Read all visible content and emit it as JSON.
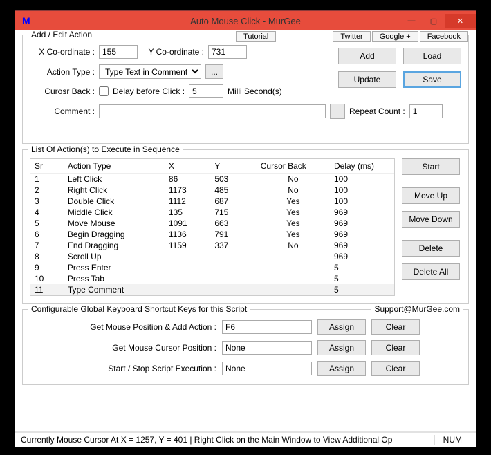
{
  "window": {
    "title": "Auto Mouse Click - MurGee",
    "icon_letter": "M"
  },
  "links": {
    "tutorial": "Tutorial",
    "twitter": "Twitter",
    "google": "Google +",
    "facebook": "Facebook"
  },
  "addEdit": {
    "legend": "Add / Edit Action",
    "xcoord_lbl": "X Co-ordinate :",
    "xcoord_val": "155",
    "ycoord_lbl": "Y Co-ordinate :",
    "ycoord_val": "731",
    "action_type_lbl": "Action Type :",
    "action_type_val": "Type Text in Comment",
    "ellipsis": "...",
    "cursor_back_lbl": "Curosr Back :",
    "delay_lbl": "Delay before Click :",
    "delay_val": "5",
    "delay_unit": "Milli Second(s)",
    "comment_lbl": "Comment :",
    "repeat_lbl": "Repeat Count :",
    "repeat_val": "1",
    "add_btn": "Add",
    "load_btn": "Load",
    "update_btn": "Update",
    "save_btn": "Save"
  },
  "list": {
    "legend": "List Of Action(s) to Execute in Sequence",
    "headers": {
      "sr": "Sr",
      "type": "Action Type",
      "x": "X",
      "y": "Y",
      "cb": "Cursor Back",
      "delay": "Delay (ms)"
    },
    "rows": [
      {
        "sr": "1",
        "type": "Left Click",
        "x": "86",
        "y": "503",
        "cb": "No",
        "delay": "100"
      },
      {
        "sr": "2",
        "type": "Right Click",
        "x": "1173",
        "y": "485",
        "cb": "No",
        "delay": "100"
      },
      {
        "sr": "3",
        "type": "Double Click",
        "x": "1112",
        "y": "687",
        "cb": "Yes",
        "delay": "100"
      },
      {
        "sr": "4",
        "type": "Middle Click",
        "x": "135",
        "y": "715",
        "cb": "Yes",
        "delay": "969"
      },
      {
        "sr": "5",
        "type": "Move Mouse",
        "x": "1091",
        "y": "663",
        "cb": "Yes",
        "delay": "969"
      },
      {
        "sr": "6",
        "type": "Begin Dragging",
        "x": "1136",
        "y": "791",
        "cb": "Yes",
        "delay": "969"
      },
      {
        "sr": "7",
        "type": "End Dragging",
        "x": "1159",
        "y": "337",
        "cb": "No",
        "delay": "969"
      },
      {
        "sr": "8",
        "type": "Scroll Up",
        "x": "",
        "y": "",
        "cb": "",
        "delay": "969"
      },
      {
        "sr": "9",
        "type": "Press Enter",
        "x": "",
        "y": "",
        "cb": "",
        "delay": "5"
      },
      {
        "sr": "10",
        "type": "Press Tab",
        "x": "",
        "y": "",
        "cb": "",
        "delay": "5"
      },
      {
        "sr": "11",
        "type": "Type Comment",
        "x": "",
        "y": "",
        "cb": "",
        "delay": "5"
      }
    ],
    "start_btn": "Start",
    "moveup_btn": "Move Up",
    "movedown_btn": "Move Down",
    "delete_btn": "Delete",
    "deleteall_btn": "Delete All"
  },
  "shortcuts": {
    "legend": "Configurable Global Keyboard Shortcut Keys for this Script",
    "support": "Support@MurGee.com",
    "row1_lbl": "Get Mouse Position & Add Action :",
    "row1_val": "F6",
    "row2_lbl": "Get Mouse Cursor Position :",
    "row2_val": "None",
    "row3_lbl": "Start / Stop Script Execution :",
    "row3_val": "None",
    "assign_btn": "Assign",
    "clear_btn": "Clear"
  },
  "status": {
    "text": "Currently Mouse Cursor At X = 1257, Y = 401 | Right Click on the Main Window to View Additional Op",
    "num": "NUM"
  }
}
